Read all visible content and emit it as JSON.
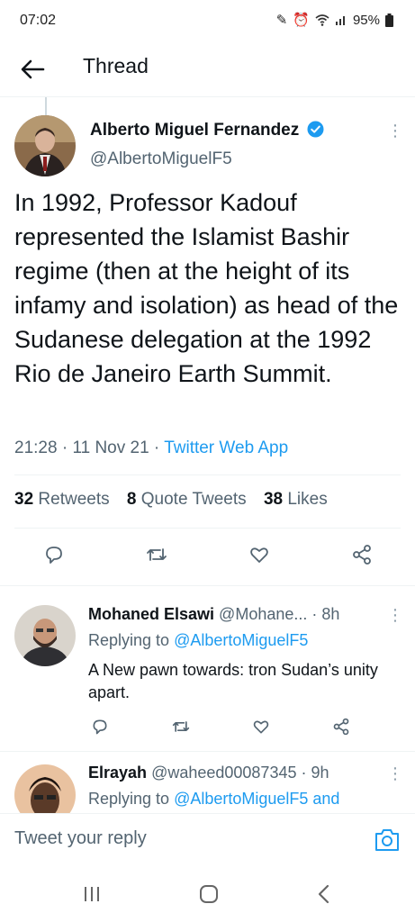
{
  "status": {
    "time": "07:02",
    "battery": "95%"
  },
  "header": {
    "title": "Thread"
  },
  "tweet": {
    "name": "Alberto Miguel Fernandez",
    "handle": "@AlbertoMiguelF5",
    "text": "In 1992, Professor Kadouf represented the Islamist Bashir regime (then at the height of its infamy and isolation) as head of the Sudanese delegation at the 1992 Rio de Janeiro Earth Summit.",
    "time": "21:28",
    "date": "11 Nov 21",
    "source": "Twitter Web App",
    "retweets_count": "32",
    "retweets_label": "Retweets",
    "quotes_count": "8",
    "quotes_label": "Quote Tweets",
    "likes_count": "38",
    "likes_label": "Likes"
  },
  "replies": [
    {
      "name": "Mohaned Elsawi",
      "handle": "@Mohane...",
      "age": "· 8h",
      "replying_prefix": "Replying to",
      "replying_to": "@AlbertoMiguelF5",
      "text": "A New pawn towards: tron Sudan’s unity apart."
    },
    {
      "name": "Elrayah",
      "handle": "@waheed00087345",
      "age": "· 9h",
      "replying_prefix": "Replying to",
      "replying_to": "@AlbertoMiguelF5 and"
    }
  ],
  "composer": {
    "placeholder": "Tweet your reply"
  },
  "colors": {
    "accent": "#1d9bf0",
    "text": "#0f1419",
    "muted": "#536471"
  }
}
